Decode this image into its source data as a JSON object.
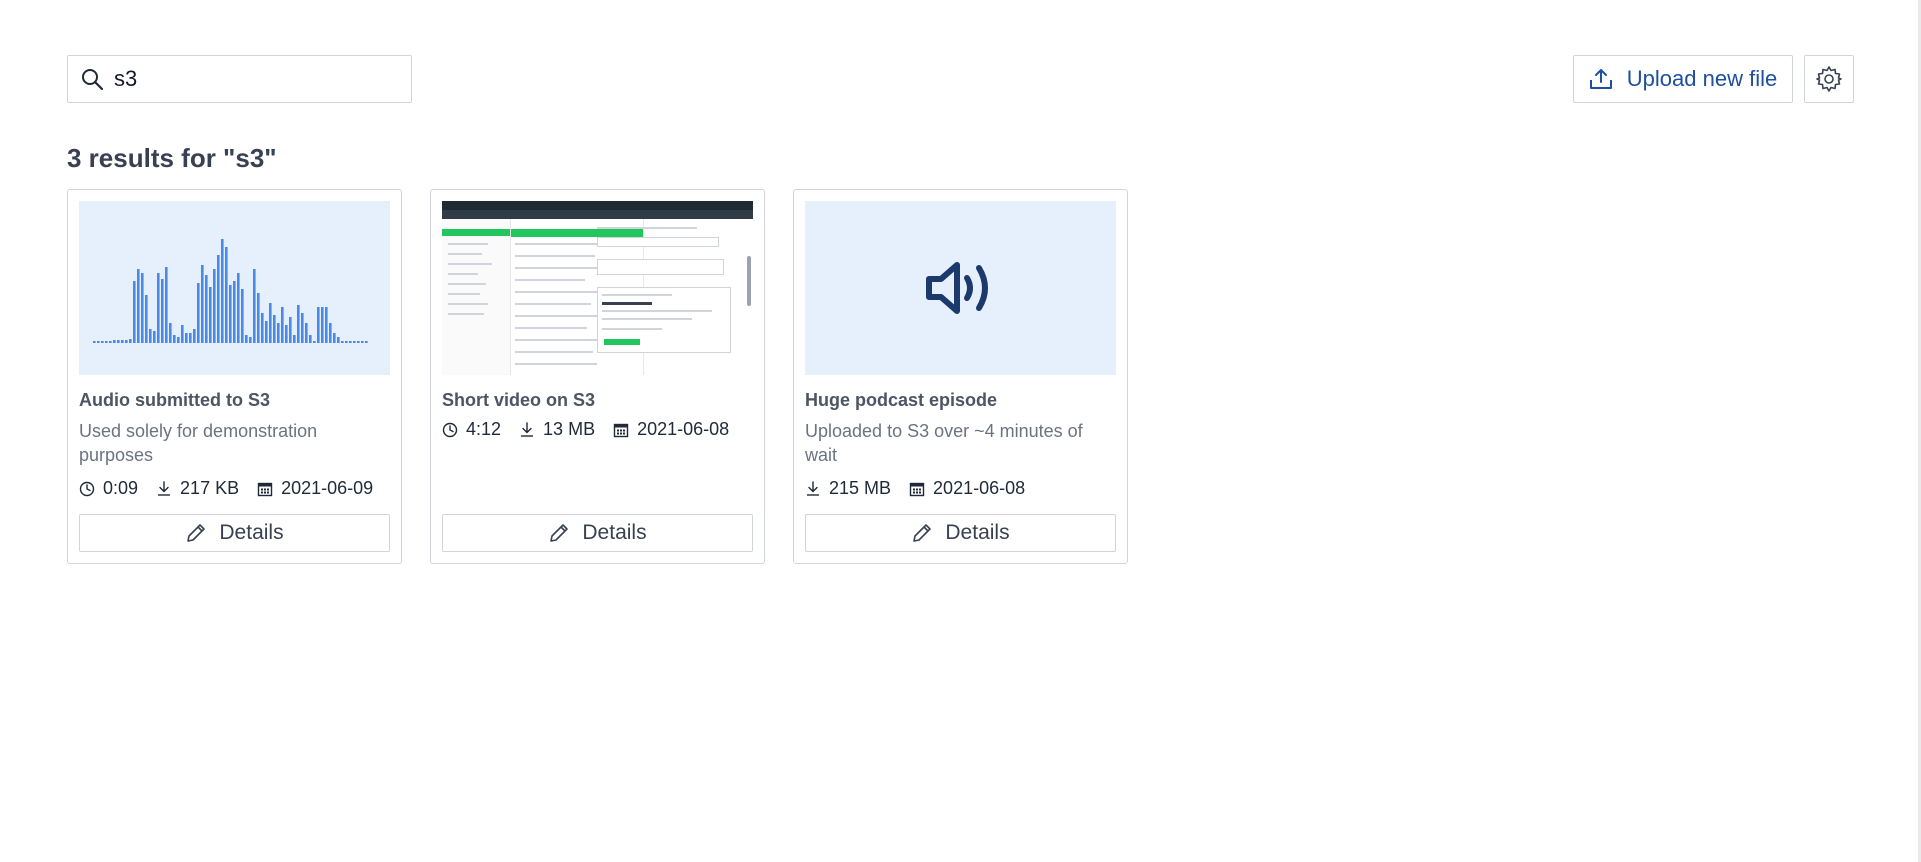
{
  "search": {
    "value": "s3",
    "icon": "magnifier"
  },
  "toolbar": {
    "upload_label": "Upload new file",
    "upload_icon": "upload-tray",
    "settings_icon": "gear"
  },
  "results": {
    "title": "3 results for \"s3\""
  },
  "cards": [
    {
      "title": "Audio submitted to S3",
      "description": "Used solely for demonstration purposes",
      "duration": "0:09",
      "size": "217 KB",
      "date": "2021-06-09",
      "thumbnail": "waveform",
      "details_label": "Details"
    },
    {
      "title": "Short video on S3",
      "description": "",
      "duration": "4:12",
      "size": "13 MB",
      "date": "2021-06-08",
      "thumbnail": "screen-recording",
      "details_label": "Details"
    },
    {
      "title": "Huge podcast episode",
      "description": "Uploaded to S3 over ~4 minutes of wait",
      "size": "215 MB",
      "date": "2021-06-08",
      "thumbnail": "speaker-icon",
      "details_label": "Details"
    }
  ],
  "colors": {
    "accent": "#1e4fa1",
    "thumb_bg": "#e6f0fc",
    "wave": "#4a8ae6",
    "speaker": "#1b3a6b"
  }
}
